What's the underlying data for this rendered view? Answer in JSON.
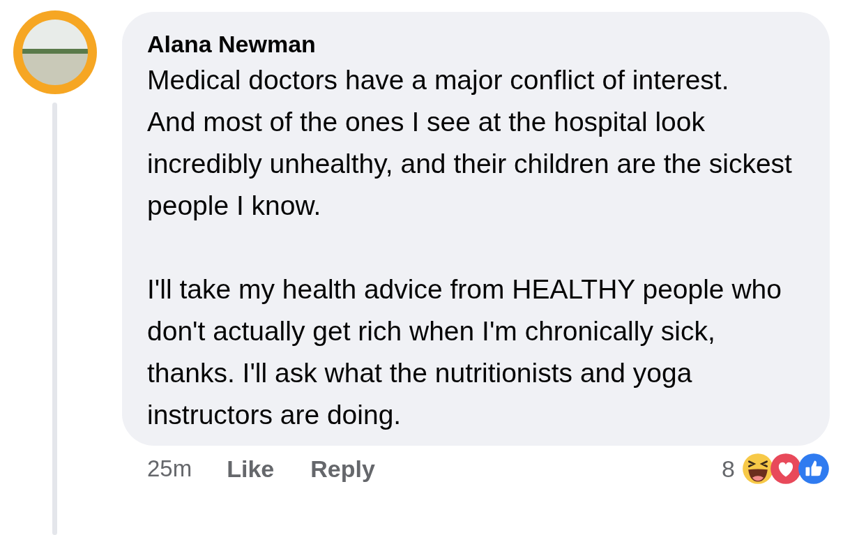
{
  "comment": {
    "author": "Alana Newman",
    "text": "Medical doctors have a major conflict of interest.\nAnd most of the ones I see at the hospital look incredibly unhealthy, and their children are the sickest people I know.\n\nI'll take my health advice from HEALTHY people who don't actually get rich when I'm chronically sick, thanks. I'll ask what the nutritionists and yoga instructors are doing.",
    "time": "25m",
    "actions": [
      "Like",
      "Reply"
    ],
    "reaction_count": "8"
  }
}
